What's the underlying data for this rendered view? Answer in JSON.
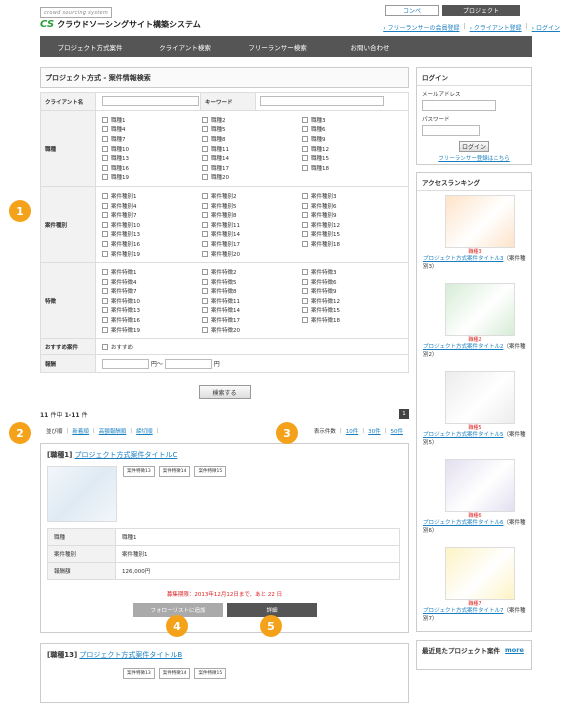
{
  "header": {
    "tagline": "crowd sourcing system",
    "logo_mark": "CS",
    "site_title": "クラウドソーシングサイト構築システム",
    "btn_company": "コンペ",
    "btn_project": "プロジェクト",
    "links": [
      "フリーランサーの会員登録",
      "クライアント登録",
      "ログイン"
    ]
  },
  "nav": [
    "プロジェクト方式案件",
    "クライアント検索",
    "フリーランサー検索",
    "お問い合わせ"
  ],
  "search": {
    "heading": "プロジェクト方式 - 案件情報検索",
    "client_label": "クライアント名",
    "keyword_label": "キーワード",
    "job_label": "職種",
    "job_items": [
      "職種1",
      "職種2",
      "職種3",
      "職種4",
      "職種5",
      "職種6",
      "職種7",
      "職種8",
      "職種9",
      "職種10",
      "職種11",
      "職種12",
      "職種13",
      "職種14",
      "職種15",
      "職種16",
      "職種17",
      "職種18",
      "職種19",
      "職種20"
    ],
    "type_label": "案件種別",
    "type_items": [
      "案件種別1",
      "案件種別2",
      "案件種別3",
      "案件種別4",
      "案件種別5",
      "案件種別6",
      "案件種別7",
      "案件種別8",
      "案件種別9",
      "案件種別10",
      "案件種別11",
      "案件種別12",
      "案件種別13",
      "案件種別14",
      "案件種別15",
      "案件種別16",
      "案件種別17",
      "案件種別18",
      "案件種別19",
      "案件種別20"
    ],
    "feature_label": "特徴",
    "feature_items": [
      "案件特徴1",
      "案件特徴2",
      "案件特徴3",
      "案件特徴4",
      "案件特徴5",
      "案件特徴6",
      "案件特徴7",
      "案件特徴8",
      "案件特徴9",
      "案件特徴10",
      "案件特徴11",
      "案件特徴12",
      "案件特徴13",
      "案件特徴14",
      "案件特徴15",
      "案件特徴16",
      "案件特徴17",
      "案件特徴18",
      "案件特徴19",
      "案件特徴20"
    ],
    "recommend_label": "おすすめ案件",
    "recommend_item": "おすすめ",
    "reward_label": "報酬",
    "reward_from_unit": "円〜",
    "reward_to_unit": "円",
    "submit": "検索する"
  },
  "results": {
    "count_total": "11",
    "count_mid": "件中",
    "count_range": "1-11",
    "count_unit": "件",
    "page": "1",
    "sort_label": "並び順",
    "sort_options": [
      "新着順",
      "高額報酬順",
      "締切順"
    ],
    "perpage_label": "表示件数",
    "perpage_options": [
      "10件",
      "30件",
      "50件"
    ]
  },
  "card1": {
    "bracket": "[職種1]",
    "title": "プロジェクト方式案件タイトルC",
    "tags": [
      "案件特徴13",
      "案件特徴14",
      "案件特徴15"
    ],
    "rows": [
      {
        "label": "職種",
        "value": "職種1"
      },
      {
        "label": "案件種別",
        "value": "案件種別1"
      },
      {
        "label": "報酬額",
        "value": "126,000円"
      }
    ],
    "deadline": "募集期限：2013年12月12日まで、あと 22 日",
    "follow": "フォローリストに追加",
    "detail": "詳細"
  },
  "card2": {
    "bracket": "[職種13]",
    "title": "プロジェクト方式案件タイトルB",
    "tags": [
      "案件特徴13",
      "案件特徴14",
      "案件特徴15"
    ]
  },
  "annotations": [
    "1",
    "2",
    "3",
    "4",
    "5"
  ],
  "login": {
    "heading": "ログイン",
    "email_label": "メールアドレス",
    "password_label": "パスワード",
    "button": "ログイン",
    "register_link": "フリーランサー登録はこちら"
  },
  "ranking": {
    "heading": "アクセスランキング",
    "items": [
      {
        "job": "職種3",
        "title": "プロジェクト方式案件タイトル3",
        "suffix": "（案件種別3）",
        "color": "#fde3c8"
      },
      {
        "job": "職種2",
        "title": "プロジェクト方式案件タイトル2",
        "suffix": "（案件種別2）",
        "color": "#d6ecd6"
      },
      {
        "job": "職種5",
        "title": "プロジェクト方式案件タイトル5",
        "suffix": "（案件種別5）",
        "color": "#ececec"
      },
      {
        "job": "職種6",
        "title": "プロジェクト方式案件タイトル6",
        "suffix": "（案件種別6）",
        "color": "#e3dff0"
      },
      {
        "job": "職種7",
        "title": "プロジェクト方式案件タイトル7",
        "suffix": "（案件種別7）",
        "color": "#fdf3c4"
      }
    ]
  },
  "recent": {
    "heading": "最近見たプロジェクト案件",
    "more": "more"
  },
  "colors": {
    "accent": "#f5a21b",
    "nav": "#555555",
    "link": "#1a7fc1",
    "deadline": "#dd2222"
  }
}
